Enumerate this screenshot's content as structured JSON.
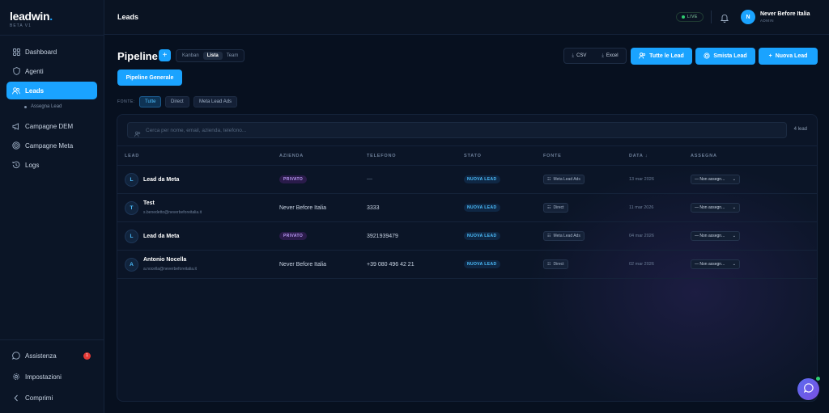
{
  "brand": {
    "name": "leadwin",
    "dot": ".",
    "subtitle": "BETA V1"
  },
  "sidebar": {
    "items": [
      {
        "label": "Dashboard",
        "icon": "grid-icon"
      },
      {
        "label": "Agenti",
        "icon": "shield-icon"
      },
      {
        "label": "Leads",
        "icon": "users-icon",
        "active": true
      },
      {
        "label": "Campagne DEM",
        "icon": "megaphone-icon"
      },
      {
        "label": "Campagne Meta",
        "icon": "target-icon"
      },
      {
        "label": "Logs",
        "icon": "history-icon"
      }
    ],
    "subitem": "Assegna Lead",
    "bottom": [
      {
        "label": "Assistenza",
        "icon": "chat-icon",
        "badge": "1"
      },
      {
        "label": "Impostazioni",
        "icon": "gear-icon"
      },
      {
        "label": "Comprimi",
        "icon": "chevron-left-icon"
      }
    ]
  },
  "topbar": {
    "title": "Leads",
    "live": "LIVE",
    "user": {
      "initial": "N",
      "name": "Never Before Italia",
      "role": "ADMIN"
    }
  },
  "header": {
    "title": "Pipeline",
    "add": "+",
    "views": [
      "Kanban",
      "Lista",
      "Team"
    ],
    "active_view": "Lista",
    "pipeline_button": "Pipeline Generale",
    "source_label": "FONTE:",
    "sources": [
      "Tutte",
      "Direct",
      "Meta Lead Ads"
    ],
    "export": {
      "csv": "CSV",
      "excel": "Excel"
    },
    "actions": {
      "all": "Tutte le Lead",
      "sort": "Smista Lead",
      "new": "Nuova Lead"
    }
  },
  "table": {
    "search_placeholder": "Cerca per nome, email, azienda, telefono...",
    "count": "4 lead",
    "columns": [
      "LEAD",
      "AZIENDA",
      "TELEFONO",
      "STATO",
      "FONTE",
      "DATA ↓",
      "ASSEGNA"
    ],
    "rows": [
      {
        "initial": "L",
        "name": "Lead da Meta",
        "email": "",
        "company": "PRIVATO",
        "company_is_badge": true,
        "phone": "—",
        "status": "NUOVA LEAD",
        "source": "Meta Lead Ads",
        "date": "13 mar 2026",
        "assign": "— Non assegn..."
      },
      {
        "initial": "T",
        "name": "Test",
        "email": "s.benedetto@neverbeforeitalia.it",
        "company": "Never Before Italia",
        "company_is_badge": false,
        "phone": "3333",
        "status": "NUOVA LEAD",
        "source": "Direct",
        "date": "11 mar 2026",
        "assign": "— Non assegn..."
      },
      {
        "initial": "L",
        "name": "Lead da Meta",
        "email": "",
        "company": "PRIVATO",
        "company_is_badge": true,
        "phone": "3921939479",
        "status": "NUOVA LEAD",
        "source": "Meta Lead Ads",
        "date": "04 mar 2026",
        "assign": "— Non assegn..."
      },
      {
        "initial": "A",
        "name": "Antonio Nocella",
        "email": "a.nocella@neverbeforeitalia.it",
        "company": "Never Before Italia",
        "company_is_badge": false,
        "phone": "+39 080 496 42 21",
        "status": "NUOVA LEAD",
        "source": "Direct",
        "date": "02 mar 2026",
        "assign": "— Non assegn..."
      }
    ]
  },
  "colors": {
    "accent": "#1aa3ff",
    "background": "#07101f",
    "private_badge": "#b99af5",
    "live": "#2ecc71"
  }
}
